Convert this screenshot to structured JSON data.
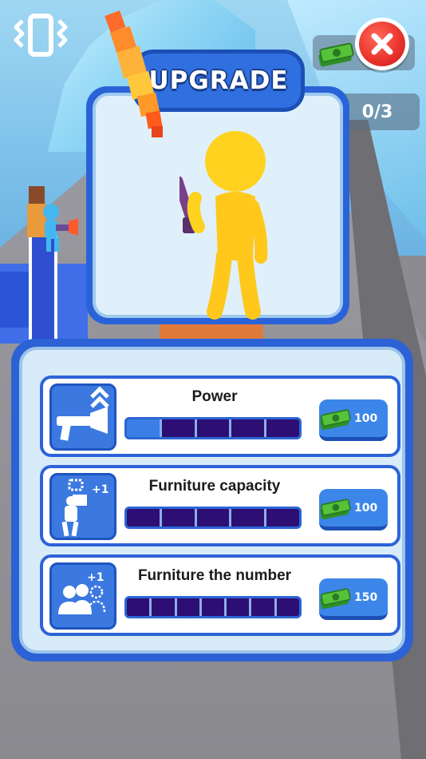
{
  "hud": {
    "vibrate_icon": "vibrate-phone-icon",
    "money_icon": "cash-stack-icon",
    "close_icon": "close-x-icon",
    "progress": "0/3"
  },
  "preview": {
    "title": "UPGRADE",
    "character": "yellow-stickman-with-flamethrower"
  },
  "upgrades": [
    {
      "label": "Power",
      "icon": "flamethrower-upgrade-icon",
      "price": "100",
      "level": 1,
      "max": 5
    },
    {
      "label": "Furniture capacity",
      "icon": "carry-box-plus-one-icon",
      "price": "100",
      "level": 0,
      "max": 5
    },
    {
      "label": "Furniture the number",
      "icon": "add-people-plus-one-icon",
      "price": "150",
      "level": 0,
      "max": 7
    }
  ],
  "colors": {
    "panel_blue": "#2c62d6",
    "segment_empty": "#2d0e74",
    "segment_filled": "#3a7ee6",
    "close_red": "#e8312b",
    "hero_yellow": "#ffd21f"
  }
}
